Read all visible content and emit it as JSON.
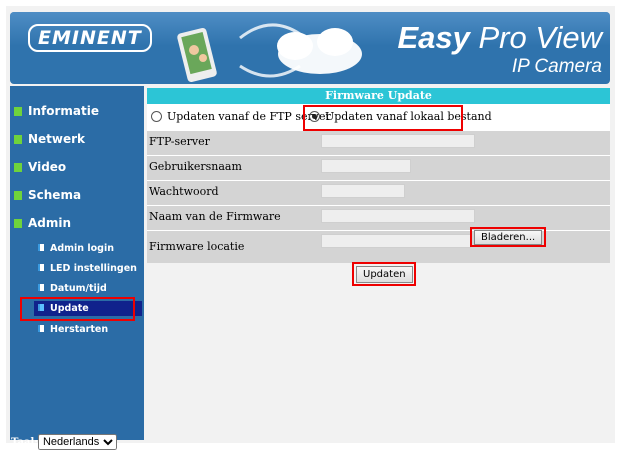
{
  "header": {
    "logo": "EMINENT",
    "title_bold": "Easy",
    "title_rest": " Pro View",
    "subtitle": "IP Camera"
  },
  "sidebar": {
    "items": [
      {
        "label": "Informatie"
      },
      {
        "label": "Netwerk"
      },
      {
        "label": "Video"
      },
      {
        "label": "Schema"
      },
      {
        "label": "Admin"
      }
    ],
    "sub_items": [
      {
        "label": "Admin login"
      },
      {
        "label": "LED instellingen"
      },
      {
        "label": "Datum/tijd"
      },
      {
        "label": "Update"
      },
      {
        "label": "Herstarten"
      }
    ],
    "language_label": "Taal:",
    "language_value": "Nederlands"
  },
  "panel": {
    "title": "Firmware Update",
    "radio_ftp": "Updaten vanaf de FTP server",
    "radio_local": "Updaten vanaf lokaal bestand",
    "fields": [
      {
        "label": "FTP-server",
        "value": ""
      },
      {
        "label": "Gebruikersnaam",
        "value": ""
      },
      {
        "label": "Wachtwoord",
        "value": ""
      },
      {
        "label": "Naam van de Firmware",
        "value": ""
      },
      {
        "label": "Firmware locatie",
        "value": ""
      }
    ],
    "browse_label": "Bladeren...",
    "update_label": "Updaten"
  },
  "colors": {
    "accent": "#2cc5d6",
    "sidebar": "#2b6ca6",
    "highlight": "#e00000"
  }
}
